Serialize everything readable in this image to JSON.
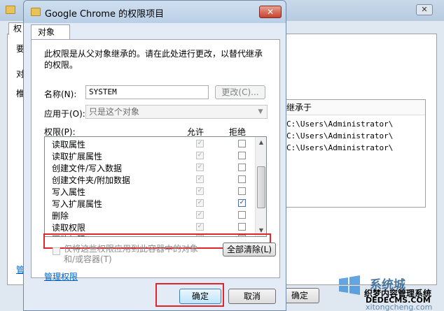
{
  "background_window": {
    "tab_label_fragment": "权",
    "side_fragments": [
      "要",
      "对",
      "椎"
    ],
    "table_header": "继承于",
    "table_rows": [
      "C:\\Users\\Administrator\\",
      "C:\\Users\\Administrator\\",
      "C:\\Users\\Administrator\\"
    ],
    "ok_label": "确定",
    "link_fragment": "管",
    "close_symbol": "✕"
  },
  "dialog": {
    "title": "Google Chrome 的权限项目",
    "close_symbol": "✕",
    "tab_label": "对象",
    "description": "此权限是从父对象继承的。请在此处进行更改，以替代继承的权限。",
    "name_label": "名称(N):",
    "name_value": "SYSTEM",
    "change_button": "更改(C)...",
    "apply_label": "应用于(O):",
    "apply_value": "只是这个对象",
    "permissions_label": "权限(P):",
    "allow_label": "允许",
    "deny_label": "拒绝",
    "permissions": [
      {
        "name": "读取属性",
        "allow": true,
        "deny": false
      },
      {
        "name": "读取扩展属性",
        "allow": true,
        "deny": false
      },
      {
        "name": "创建文件/写入数据",
        "allow": true,
        "deny": false
      },
      {
        "name": "创建文件夹/附加数据",
        "allow": true,
        "deny": false
      },
      {
        "name": "写入属性",
        "allow": true,
        "deny": false
      },
      {
        "name": "写入扩展属性",
        "allow": true,
        "deny": true
      },
      {
        "name": "删除",
        "allow": true,
        "deny": false
      },
      {
        "name": "读取权限",
        "allow": true,
        "deny": false
      },
      {
        "name": "更改权限",
        "allow": true,
        "deny": false
      }
    ],
    "inherit_checkbox_label": "仅将这些权限应用到此容器中的对象和/或容器(T)",
    "clear_all_button": "全部清除(L)",
    "manage_link": "管理权限",
    "ok_button": "确定",
    "cancel_button": "取消"
  },
  "watermark": {
    "brand": "系统城",
    "line1": "织梦内容管理系统",
    "line2": "DEDECMS.COM",
    "line3": "xitongcheng.com"
  },
  "colors": {
    "highlight_red": "#e0262a",
    "link_blue": "#0066cc",
    "title_bar": "#b9cfe6"
  }
}
